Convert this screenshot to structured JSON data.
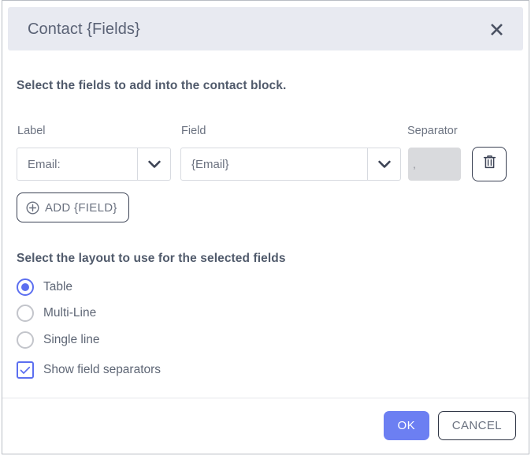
{
  "dialog": {
    "title": "Contact {Fields}",
    "close_icon": "close-icon",
    "intro": "Select the fields to add into the contact block.",
    "columns": {
      "label": "Label",
      "field": "Field",
      "separator": "Separator"
    },
    "rows": [
      {
        "label_value": "Email:",
        "field_value": "{Email}",
        "separator_value": ",",
        "separator_placeholder": "",
        "delete_icon": "trash-icon",
        "dropdown_icon": "chevron-down-icon"
      }
    ],
    "add_field": {
      "label": "ADD {FIELD}",
      "icon": "plus-circle-icon"
    },
    "layout": {
      "heading": "Select the layout to use for the selected fields",
      "options": [
        {
          "label": "Table",
          "selected": true
        },
        {
          "label": "Multi-Line",
          "selected": false
        },
        {
          "label": "Single line",
          "selected": false
        }
      ]
    },
    "checkbox": {
      "label": "Show field separators",
      "checked": true,
      "icon": "check-icon"
    },
    "footer": {
      "ok_label": "OK",
      "cancel_label": "CANCEL"
    },
    "colors": {
      "accent": "#6c7ff2",
      "radio_accent": "#5c6ff0",
      "titlebar_bg": "#e8eaf1",
      "heading_text": "#505a6b",
      "body_text": "#6b7280",
      "separator_disabled_bg": "#d9dadd",
      "outline": "#3b4254"
    }
  }
}
